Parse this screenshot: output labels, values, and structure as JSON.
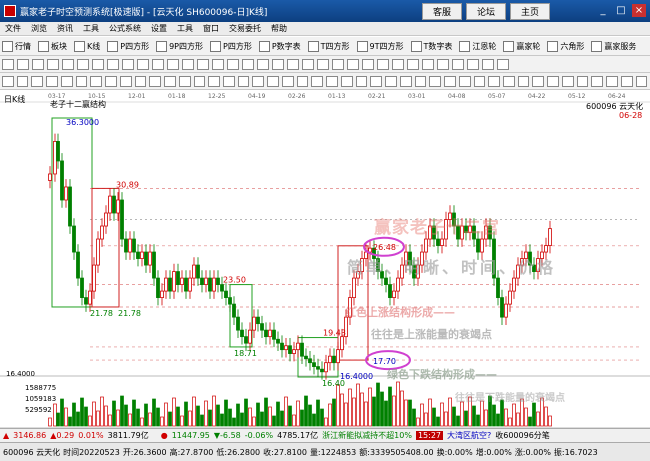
{
  "window": {
    "title": "赢家老子时空预测系统[极速版] - [云天化 SH600096-日]K线]",
    "links": [
      "客服",
      "论坛",
      "主页"
    ],
    "controls": [
      "_",
      "□",
      "×"
    ]
  },
  "menu": [
    "文件",
    "浏览",
    "资讯",
    "工具",
    "公式系统",
    "设置",
    "工具",
    "窗口",
    "交易委托",
    "帮助"
  ],
  "toolbar1": [
    {
      "label": "行情",
      "icon": "quote-icon"
    },
    {
      "label": "板块",
      "icon": "sector-icon"
    },
    {
      "label": "K线",
      "icon": "kline-icon"
    },
    {
      "label": "P四方形",
      "icon": "p-square-icon"
    },
    {
      "label": "9P四方形",
      "icon": "9p-square-icon"
    },
    {
      "label": "P四方形",
      "icon": "p-square-icon"
    },
    {
      "label": "P数字表",
      "icon": "p-number-icon"
    },
    {
      "label": "T四方形",
      "icon": "t-square-icon"
    },
    {
      "label": "9T四方形",
      "icon": "9t-square-icon"
    },
    {
      "label": "T数字表",
      "icon": "t-number-icon"
    },
    {
      "label": "江恩轮",
      "icon": "gann-wheel-icon"
    },
    {
      "label": "赢家轮",
      "icon": "winner-wheel-icon"
    },
    {
      "label": "六角形",
      "icon": "hexagon-icon"
    },
    {
      "label": "赢家服务",
      "icon": "service-icon"
    }
  ],
  "toolbar2_count": 34,
  "toolbar3_count": 44,
  "chart": {
    "period": "日K线",
    "title": "老子十二赢结构",
    "stock": "600096 云天化",
    "date": "06-28",
    "axis_dates": [
      "03-17",
      "10-15",
      "12-01",
      "01-18",
      "12-25",
      "04-19",
      "02-26",
      "01-13",
      "02-21",
      "03-01",
      "04-08",
      "05-07",
      "04-22",
      "05-12",
      "06-24"
    ],
    "price_labels": {
      "high": "36.3000",
      "p30": "30.89",
      "p23": "23.50",
      "p21a": "21.78",
      "p21b": "21.78",
      "p18": "18.71",
      "p19": "19.43",
      "p26": "26.48",
      "p17": "17.70",
      "p16a": "16.40",
      "p16b": "16.4000",
      "left16": "16.4000"
    },
    "volume_labels": [
      "1588775",
      "1059183",
      "529592"
    ],
    "watermarks": {
      "brand": "赢家老子十二宫",
      "slogan": "简单、明晰、时间、价格",
      "red_structure": "红色上涨结构形成——",
      "energy": "往往是上涨能量的衰竭点",
      "green_structure": "绿色下跌结构形成——",
      "energy2": "往往是下跌能量的衰竭点"
    }
  },
  "chart_data": {
    "type": "candlestick",
    "title": "",
    "ylim": [
      16,
      37
    ]
  },
  "status1": {
    "sh_index": "3146.86",
    "sh_change": "▲0.29",
    "sh_pct": "0.01%",
    "sh_amount": "3811.79亿",
    "sz_index": "11447.95",
    "sz_change": "▼-6.58",
    "sz_pct": "-0.06%",
    "sz_amount": "4785.17亿",
    "news": "浙江新能拟减持不超10%",
    "time": "15:27",
    "notice": "大湾区航空?",
    "analysis": "收600096分笔"
  },
  "status2": {
    "stock": "600096 云天化",
    "time": "时间20220523",
    "open": "开:26.3600",
    "high": "高:27.8700",
    "low": "低:26.2800",
    "close": "收:27.8100",
    "volume": "量:1224853",
    "amount": "额:3339505408.00",
    "turnover": "换:0.00%",
    "increase": "增:0.00%",
    "limit": "涨:0.00%",
    "change": "振:16.7023"
  }
}
